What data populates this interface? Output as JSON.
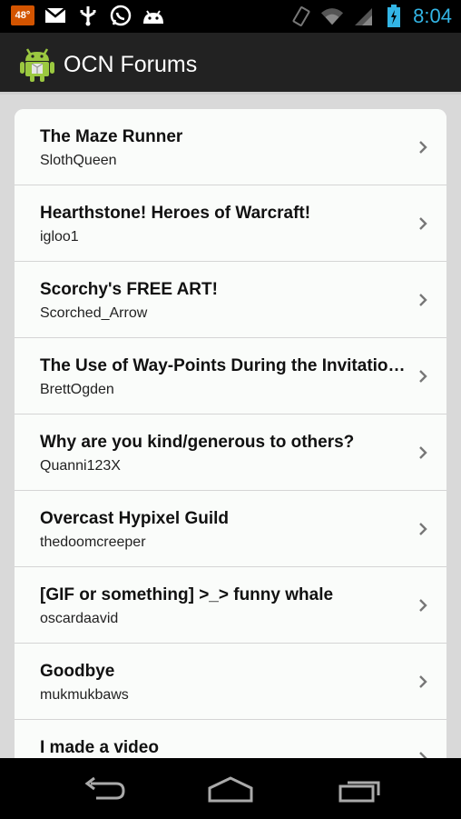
{
  "status_bar": {
    "temperature": "48°",
    "time": "8:04",
    "icons": [
      "gmail-icon",
      "usb-icon",
      "whatsapp-icon",
      "android-debug-icon",
      "vibrate-icon",
      "wifi-icon",
      "signal-icon",
      "battery-charging-icon"
    ]
  },
  "app": {
    "title": "OCN Forums",
    "icon": "android-app-icon"
  },
  "threads": [
    {
      "title": "The Maze Runner",
      "author": "SlothQueen"
    },
    {
      "title": "Hearthstone! Heroes of Warcraft!",
      "author": "igloo1"
    },
    {
      "title": "Scorchy's FREE ART!",
      "author": "Scorched_Arrow"
    },
    {
      "title": "The Use of Way-Points During the Invitation...",
      "author": "BrettOgden"
    },
    {
      "title": "Why are you kind/generous to others?",
      "author": "Quanni123X"
    },
    {
      "title": "Overcast Hypixel Guild",
      "author": "thedoomcreeper"
    },
    {
      "title": "[GIF or something] >_> funny whale",
      "author": "oscardaavid"
    },
    {
      "title": "Goodbye",
      "author": "mukmukbaws"
    },
    {
      "title": "I made a video",
      "author": ""
    }
  ],
  "nav_bar": {
    "icons": [
      "back-icon",
      "home-icon",
      "recent-apps-icon"
    ]
  }
}
